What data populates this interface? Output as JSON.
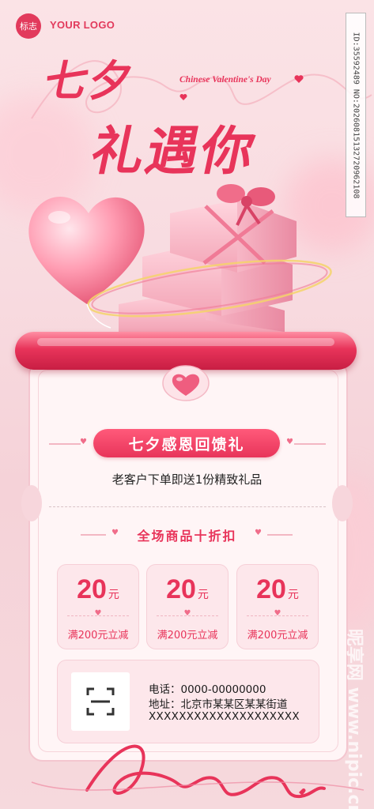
{
  "header": {
    "logo_badge": "标志",
    "logo_text": "YOUR LOGO"
  },
  "watermark": {
    "id_text": "ID:35592489 NO:20260815132720962108",
    "site": "昵享网 www.nipic.cn"
  },
  "headline": {
    "line1": "七夕",
    "line2": "礼遇你",
    "subtitle_en": "Chinese Valentine's Day"
  },
  "promo": {
    "pill_label": "七夕感恩回馈礼",
    "gift_text": "老客户下单即送1份精致礼品",
    "discount_title": "全场商品十折扣"
  },
  "coupons": [
    {
      "amount": "20",
      "unit": "元",
      "condition": "满200元立减"
    },
    {
      "amount": "20",
      "unit": "元",
      "condition": "满200元立减"
    },
    {
      "amount": "20",
      "unit": "元",
      "condition": "满200元立减"
    }
  ],
  "contact": {
    "phone": "电话：0000-00000000",
    "address": "地址：北京市某某区某某街道",
    "extra": "XXXXXXXXXXXXXXXXXXXX"
  },
  "colors": {
    "accent": "#e8345a",
    "background": "#f8dbe0",
    "card": "#fff5f6"
  },
  "icons": [
    "heart-icon",
    "scan-qr-icon",
    "gift-box-illustration",
    "heart-balloon-illustration"
  ]
}
